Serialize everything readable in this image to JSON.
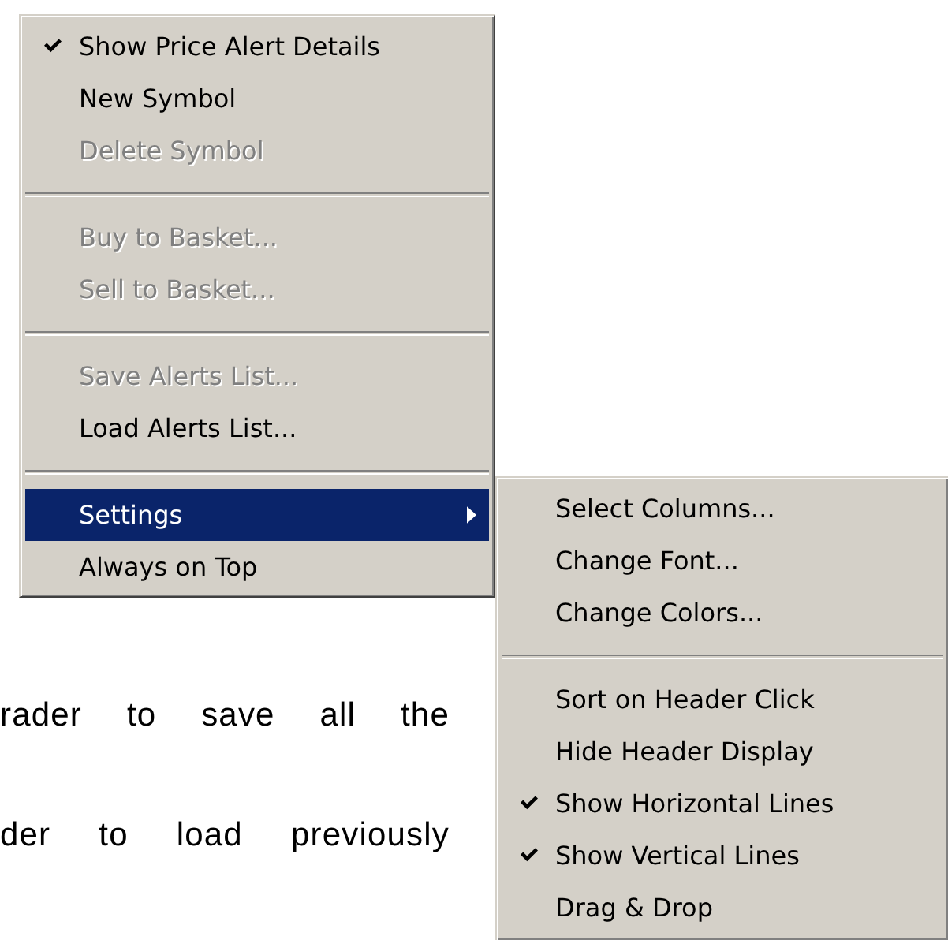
{
  "menu": {
    "items": [
      {
        "kind": "item",
        "label": "Show Price Alert Details",
        "checked": true,
        "disabled": false,
        "selected": false,
        "submenu": false
      },
      {
        "kind": "item",
        "label": "New Symbol",
        "checked": false,
        "disabled": false,
        "selected": false,
        "submenu": false
      },
      {
        "kind": "item",
        "label": "Delete Symbol",
        "checked": false,
        "disabled": true,
        "selected": false,
        "submenu": false
      },
      {
        "kind": "separator"
      },
      {
        "kind": "item",
        "label": "Buy to Basket...",
        "checked": false,
        "disabled": true,
        "selected": false,
        "submenu": false
      },
      {
        "kind": "item",
        "label": "Sell to Basket...",
        "checked": false,
        "disabled": true,
        "selected": false,
        "submenu": false
      },
      {
        "kind": "separator"
      },
      {
        "kind": "item",
        "label": "Save Alerts List...",
        "checked": false,
        "disabled": true,
        "selected": false,
        "submenu": false
      },
      {
        "kind": "item",
        "label": "Load Alerts List...",
        "checked": false,
        "disabled": false,
        "selected": false,
        "submenu": false
      },
      {
        "kind": "separator"
      },
      {
        "kind": "item",
        "label": "Settings",
        "checked": false,
        "disabled": false,
        "selected": true,
        "submenu": true
      },
      {
        "kind": "item",
        "label": "Always on Top",
        "checked": false,
        "disabled": false,
        "selected": false,
        "submenu": false
      }
    ]
  },
  "submenu": {
    "items": [
      {
        "kind": "item",
        "label": "Select Columns...",
        "checked": false,
        "disabled": false,
        "selected": false,
        "submenu": false
      },
      {
        "kind": "item",
        "label": "Change Font...",
        "checked": false,
        "disabled": false,
        "selected": false,
        "submenu": false
      },
      {
        "kind": "item",
        "label": "Change Colors...",
        "checked": false,
        "disabled": false,
        "selected": false,
        "submenu": false
      },
      {
        "kind": "separator"
      },
      {
        "kind": "item",
        "label": "Sort on Header Click",
        "checked": false,
        "disabled": false,
        "selected": false,
        "submenu": false
      },
      {
        "kind": "item",
        "label": "Hide Header Display",
        "checked": false,
        "disabled": false,
        "selected": false,
        "submenu": false
      },
      {
        "kind": "item",
        "label": "Show Horizontal Lines",
        "checked": true,
        "disabled": false,
        "selected": false,
        "submenu": false
      },
      {
        "kind": "item",
        "label": "Show Vertical Lines",
        "checked": true,
        "disabled": false,
        "selected": false,
        "submenu": false
      },
      {
        "kind": "item",
        "label": "Drag & Drop",
        "checked": false,
        "disabled": false,
        "selected": false,
        "submenu": false
      }
    ]
  },
  "page_text": [
    "rader to save all the",
    "der to load previously"
  ]
}
